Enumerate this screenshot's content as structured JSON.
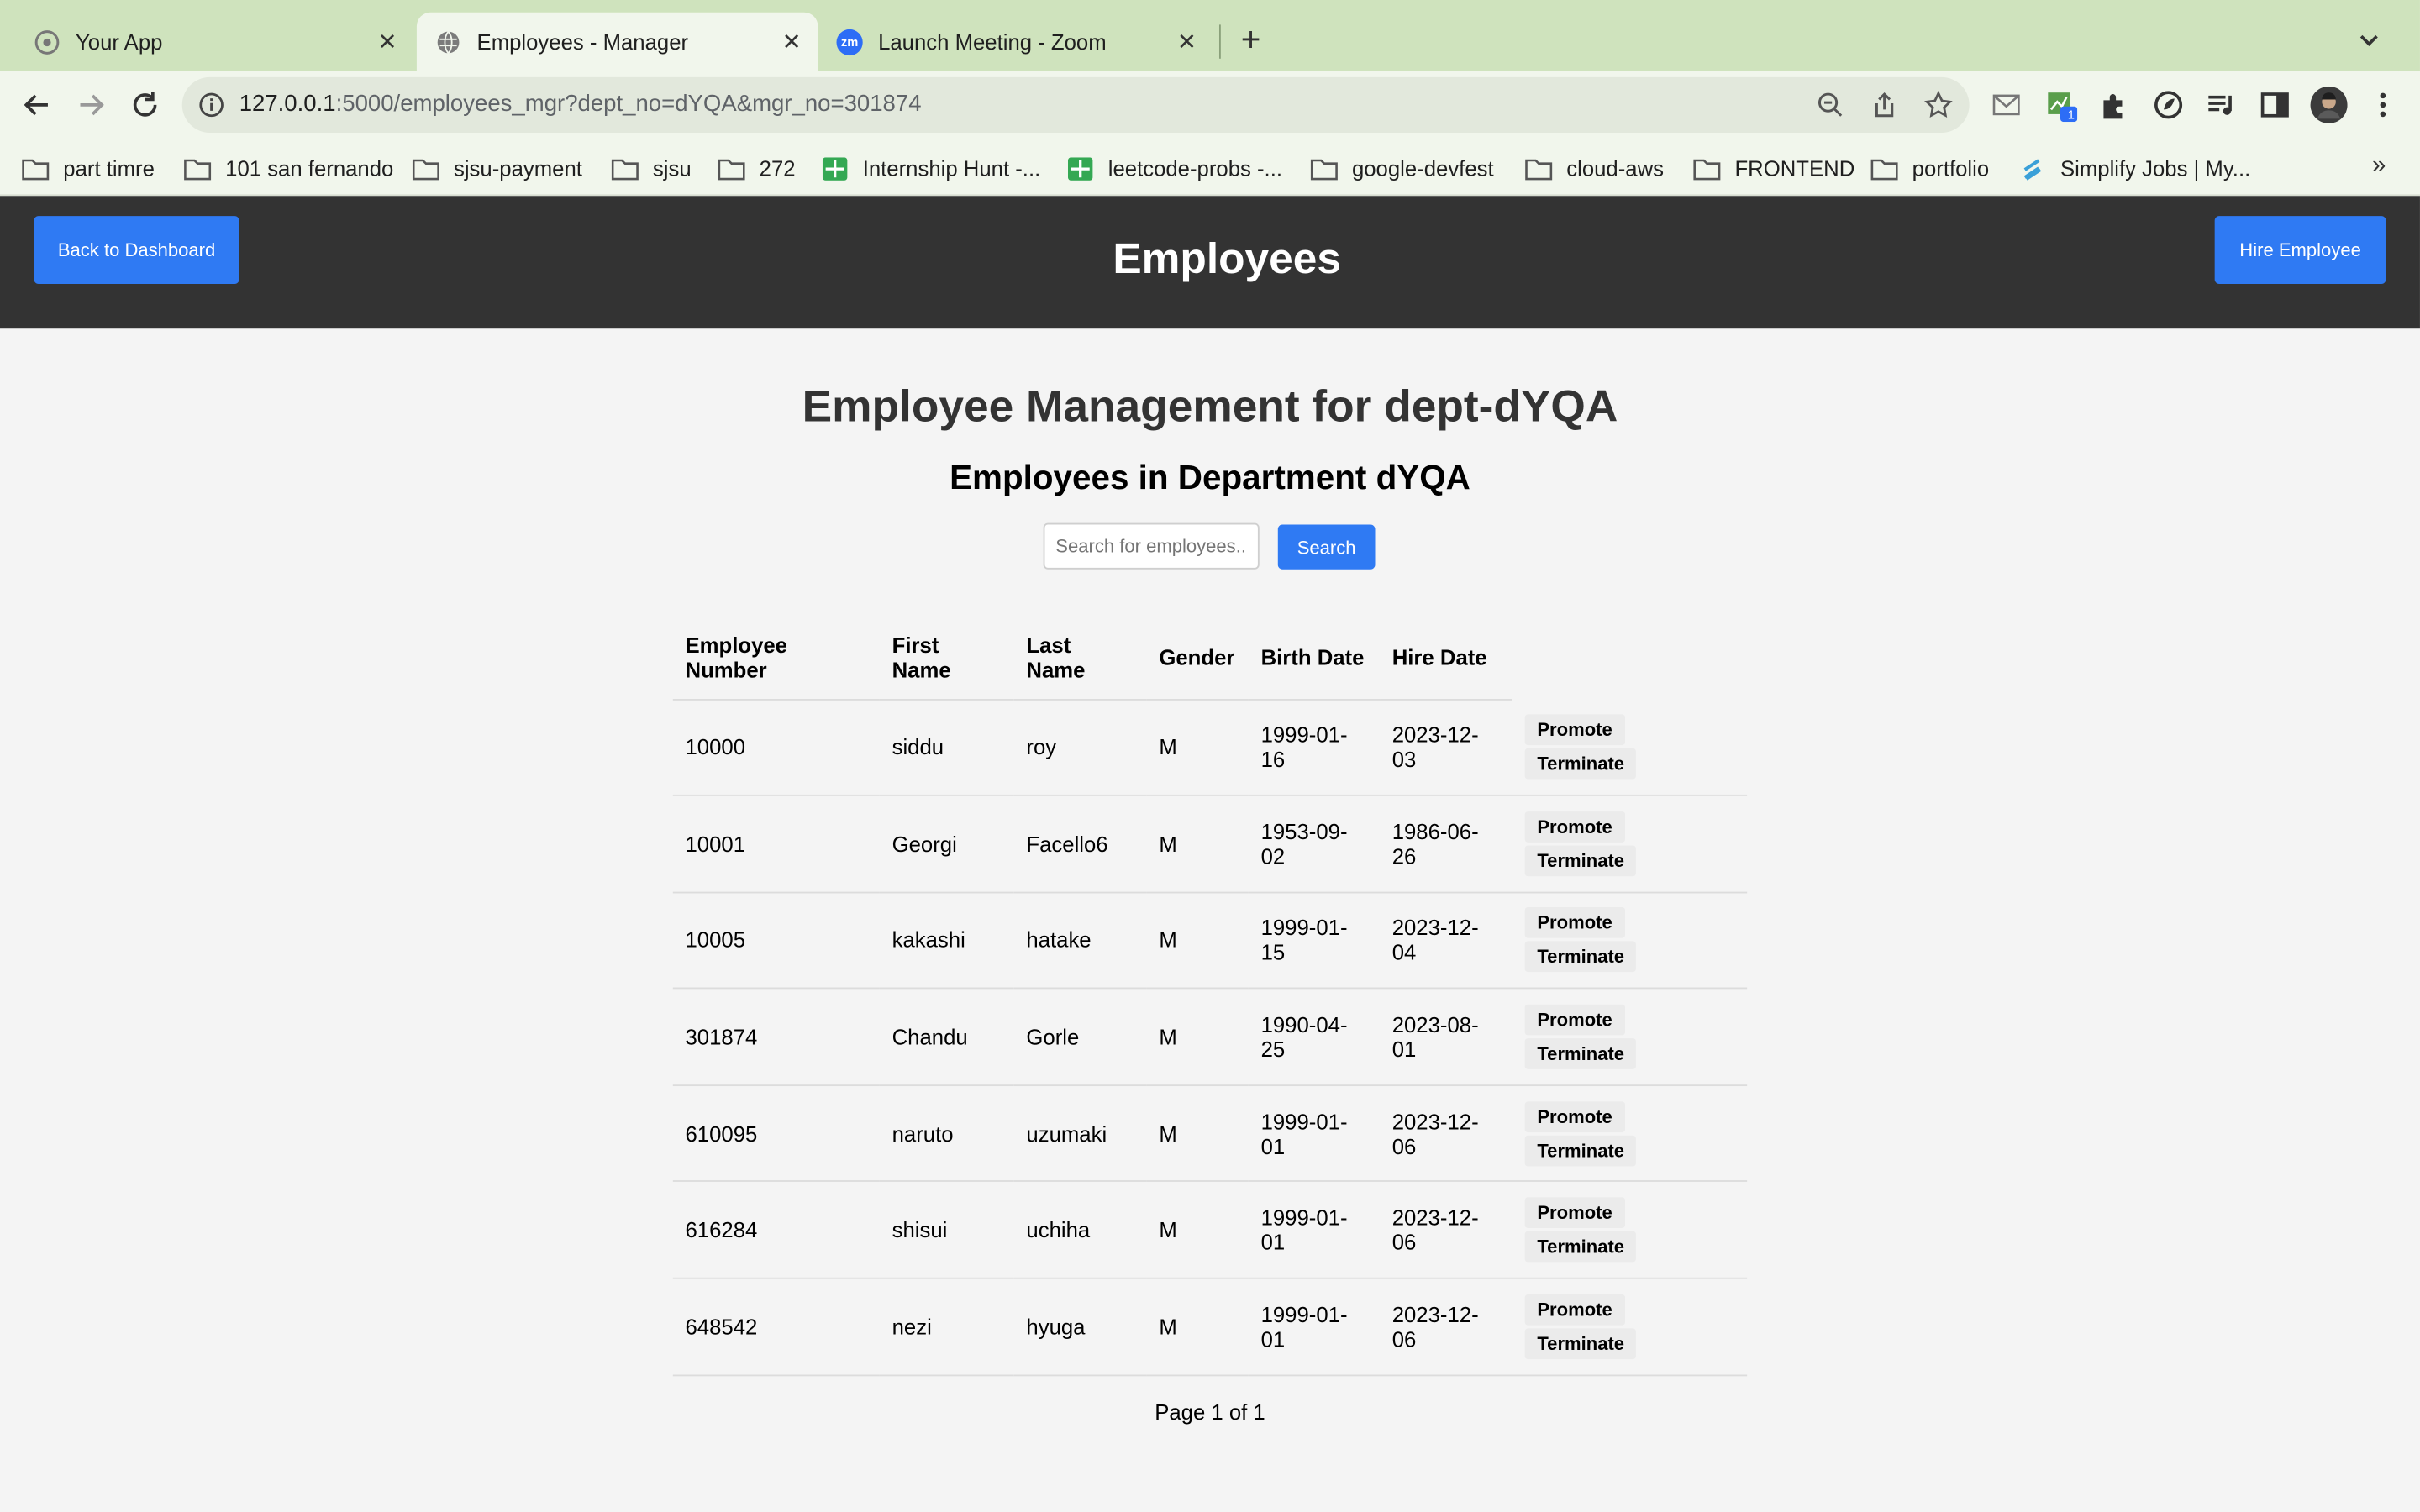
{
  "browser": {
    "tabs": [
      {
        "title": "Your App",
        "icon": "app-icon",
        "active": false
      },
      {
        "title": "Employees - Manager",
        "icon": "globe-icon",
        "active": true
      },
      {
        "title": "Launch Meeting - Zoom",
        "icon": "zoom-icon",
        "active": false,
        "icon_text": "zm"
      }
    ],
    "url_host": "127.0.0.1",
    "url_rest": ":5000/employees_mgr?dept_no=dYQA&mgr_no=301874",
    "extension_badge": "1",
    "bookmarks": [
      "part timre",
      "101 san fernando",
      "sjsu-payment",
      "sjsu",
      "272",
      "Internship Hunt -...",
      "leetcode-probs -...",
      "google-devfest",
      "cloud-aws",
      "FRONTEND",
      "portfolio",
      "Simplify Jobs | My..."
    ],
    "bookmarks_more": "»"
  },
  "header": {
    "title": "Employees",
    "back_label": "Back to Dashboard",
    "hire_label": "Hire Employee"
  },
  "main": {
    "heading": "Employee Management for dept-dYQA",
    "subheading": "Employees in Department dYQA",
    "search_placeholder": "Search for employees...",
    "search_button": "Search",
    "columns": [
      "Employee Number",
      "First Name",
      "Last Name",
      "Gender",
      "Birth Date",
      "Hire Date"
    ],
    "promote_label": "Promote",
    "terminate_label": "Terminate",
    "rows": [
      {
        "emp_no": "10000",
        "first": "siddu",
        "last": "roy",
        "gender": "M",
        "birth": "1999-01-16",
        "hire": "2023-12-03"
      },
      {
        "emp_no": "10001",
        "first": "Georgi",
        "last": "Facello6",
        "gender": "M",
        "birth": "1953-09-02",
        "hire": "1986-06-26"
      },
      {
        "emp_no": "10005",
        "first": "kakashi",
        "last": "hatake",
        "gender": "M",
        "birth": "1999-01-15",
        "hire": "2023-12-04"
      },
      {
        "emp_no": "301874",
        "first": "Chandu",
        "last": "Gorle",
        "gender": "M",
        "birth": "1990-04-25",
        "hire": "2023-08-01"
      },
      {
        "emp_no": "610095",
        "first": "naruto",
        "last": "uzumaki",
        "gender": "M",
        "birth": "1999-01-01",
        "hire": "2023-12-06"
      },
      {
        "emp_no": "616284",
        "first": "shisui",
        "last": "uchiha",
        "gender": "M",
        "birth": "1999-01-01",
        "hire": "2023-12-06"
      },
      {
        "emp_no": "648542",
        "first": "nezi",
        "last": "hyuga",
        "gender": "M",
        "birth": "1999-01-01",
        "hire": "2023-12-06"
      }
    ],
    "pagination": "Page 1 of 1"
  },
  "colors": {
    "accent": "#2f7af3",
    "header_bg": "#333333",
    "page_bg": "#f4f4f4",
    "tabbar_bg": "#cfe3bd"
  }
}
